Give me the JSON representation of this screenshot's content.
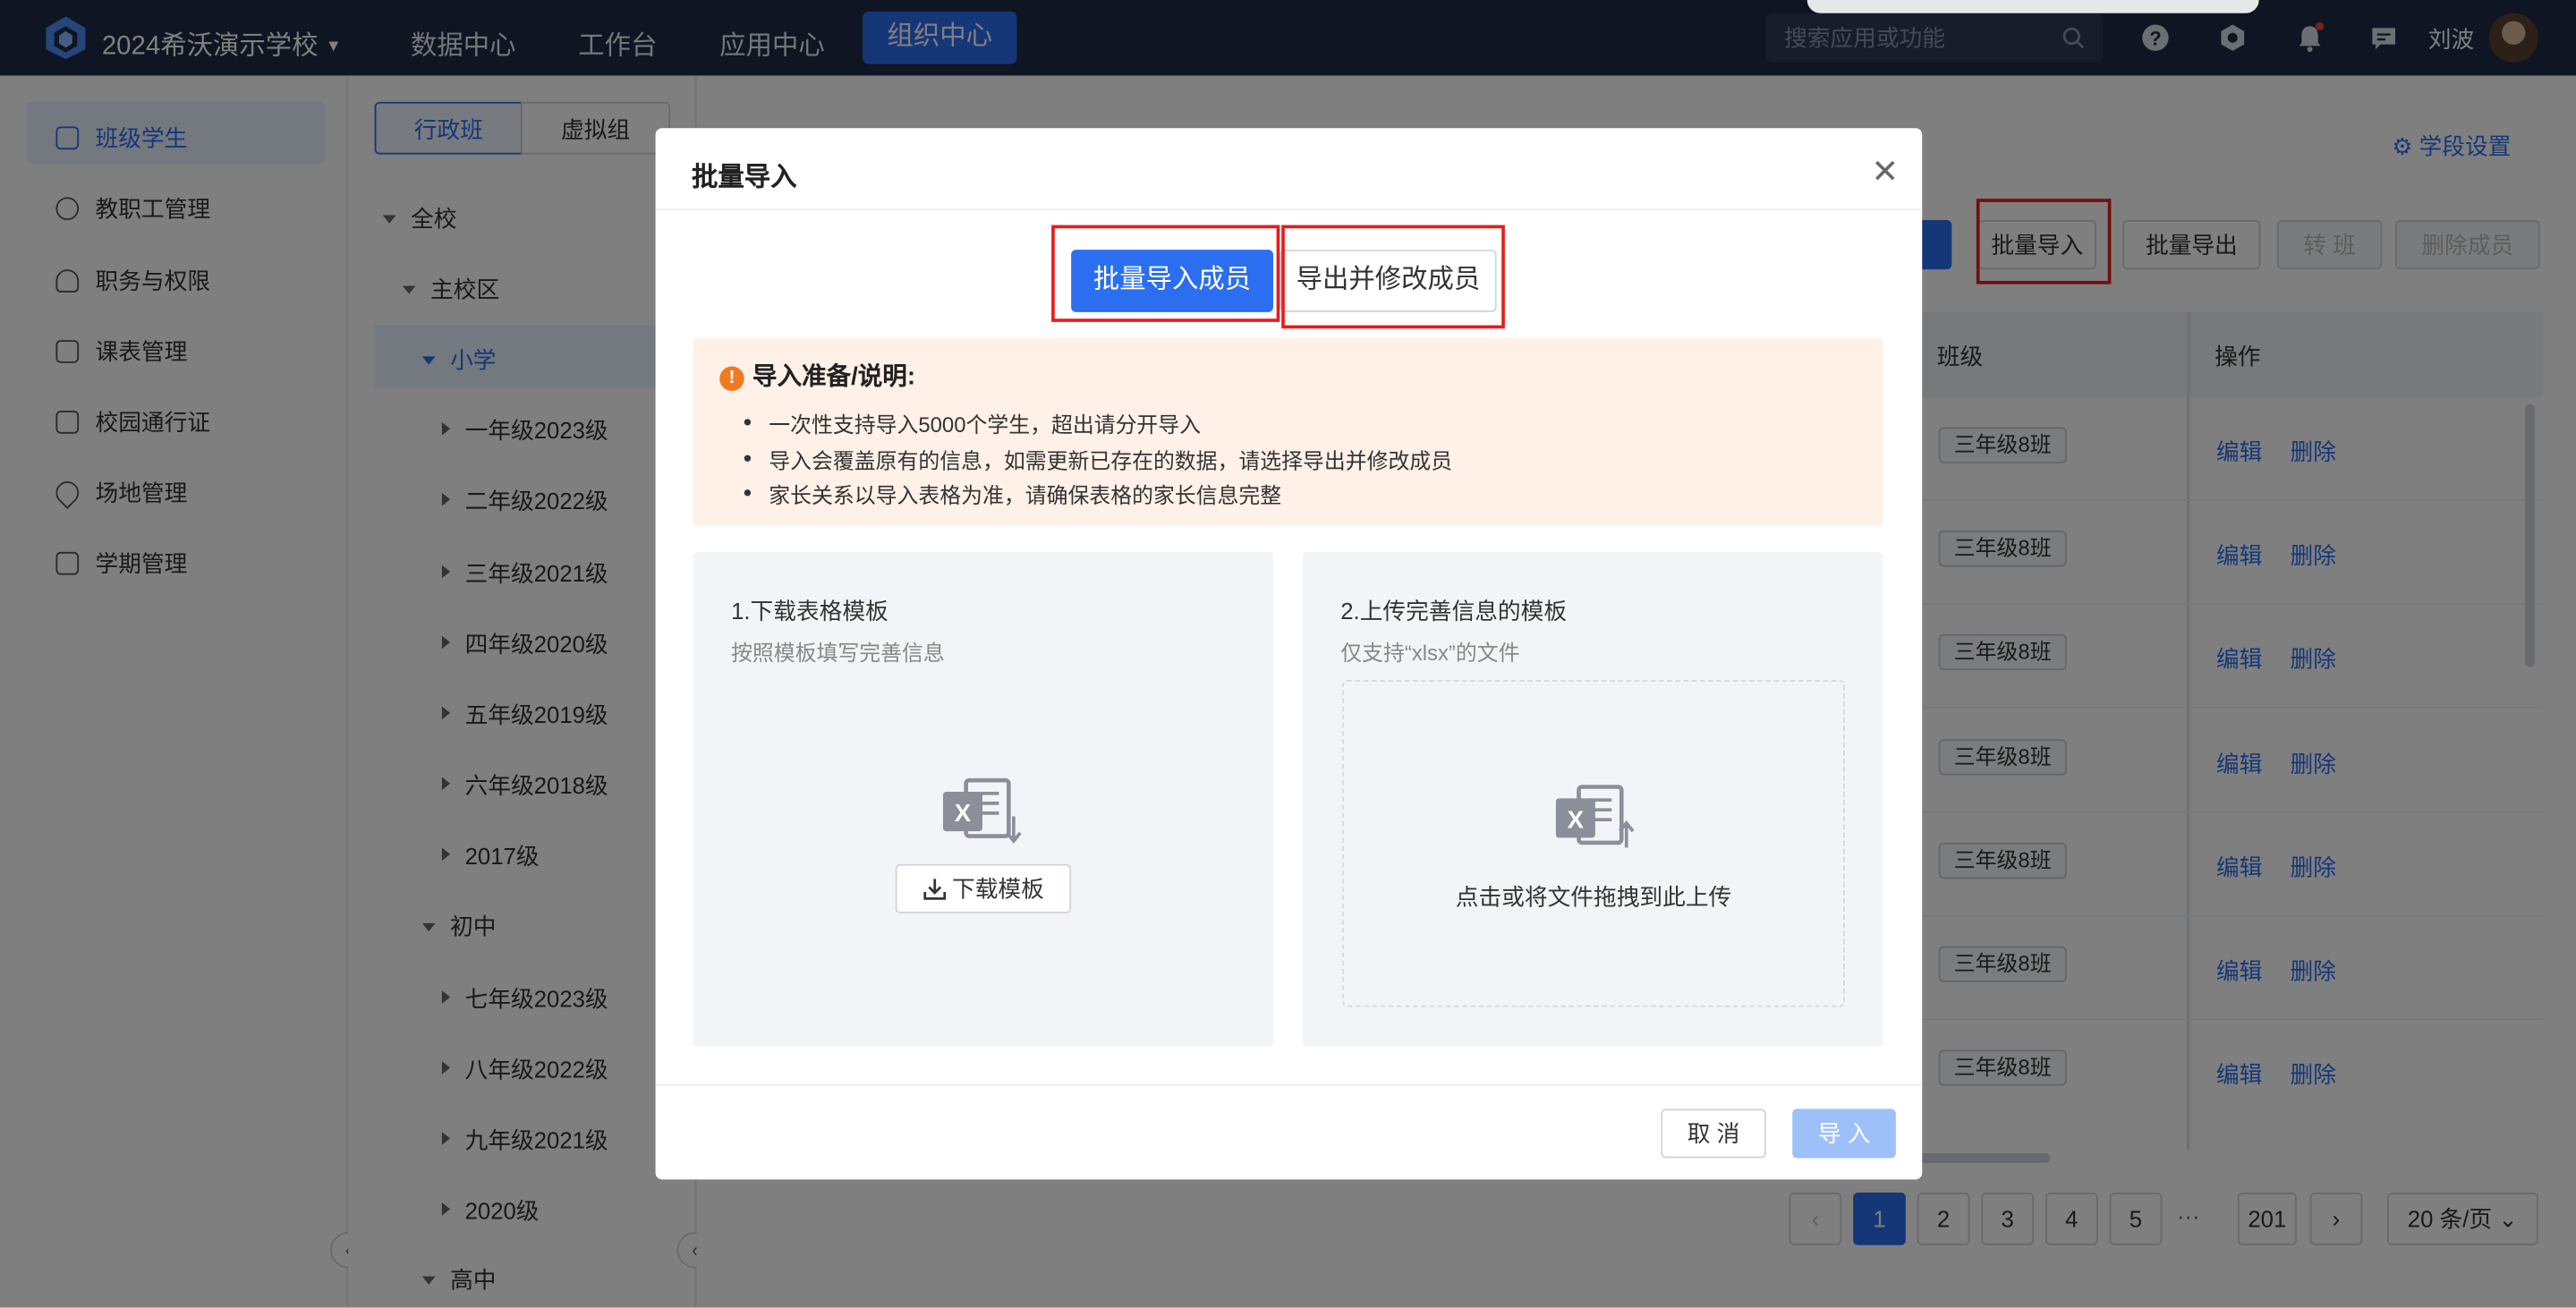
{
  "topbar": {
    "school_name": "2024希沃演示学校",
    "nav": [
      "数据中心",
      "工作台",
      "应用中心",
      "组织中心"
    ],
    "active_nav": "组织中心",
    "search_placeholder": "搜索应用或功能",
    "username": "刘波"
  },
  "sidebar": {
    "items": [
      {
        "label": "班级学生",
        "icon": "class-icon",
        "active": true
      },
      {
        "label": "教职工管理",
        "icon": "person-icon"
      },
      {
        "label": "职务与权限",
        "icon": "role-icon"
      },
      {
        "label": "课表管理",
        "icon": "calendar-icon"
      },
      {
        "label": "校园通行证",
        "icon": "card-icon"
      },
      {
        "label": "场地管理",
        "icon": "location-icon"
      },
      {
        "label": "学期管理",
        "icon": "term-icon"
      }
    ]
  },
  "tree": {
    "tabs": [
      "行政班",
      "虚拟组"
    ],
    "nodes": [
      "全校",
      "主校区",
      "小学",
      "一年级2023级",
      "二年级2022级",
      "三年级2021级",
      "四年级2020级",
      "五年级2019级",
      "六年级2018级",
      "2017级",
      "初中",
      "七年级2023级",
      "八年级2022级",
      "九年级2021级",
      "2020级",
      "高中"
    ]
  },
  "main": {
    "stage_settings": "学段设置",
    "actions": [
      "批量导入",
      "批量导出",
      "转 班",
      "删除成员"
    ],
    "table_headers": [
      "班级",
      "操作"
    ],
    "rows": [
      {
        "class": "三年级8班",
        "edit": "编辑",
        "delete": "删除"
      },
      {
        "class": "三年级8班",
        "edit": "编辑",
        "delete": "删除"
      },
      {
        "class": "三年级8班",
        "edit": "编辑",
        "delete": "删除"
      },
      {
        "class": "三年级8班",
        "edit": "编辑",
        "delete": "删除"
      },
      {
        "class": "三年级8班",
        "edit": "编辑",
        "delete": "删除"
      },
      {
        "class": "三年级8班",
        "edit": "编辑",
        "delete": "删除"
      },
      {
        "class": "三年级8班",
        "edit": "编辑",
        "delete": "删除"
      }
    ],
    "pagination": {
      "pages": [
        "1",
        "2",
        "3",
        "4",
        "5",
        "···",
        "201"
      ],
      "current": "1",
      "page_size": "20 条/页"
    }
  },
  "modal": {
    "title": "批量导入",
    "tabs": [
      "批量导入成员",
      "导出并修改成员"
    ],
    "notice": {
      "title": "导入准备/说明:",
      "items": [
        "一次性支持导入5000个学生，超出请分开导入",
        "导入会覆盖原有的信息，如需更新已存在的数据，请选择导出并修改成员",
        "家长关系以导入表格为准，请确保表格的家长信息完整"
      ]
    },
    "step1": {
      "title": "1.下载表格模板",
      "subtitle": "按照模板填写完善信息",
      "button": "下载模板"
    },
    "step2": {
      "title": "2.上传完善信息的模板",
      "subtitle": "仅支持“xlsx”的文件",
      "drop_text": "点击或将文件拖拽到此上传"
    },
    "cancel": "取 消",
    "import": "导 入"
  },
  "colors": {
    "primary": "#2b6ff0",
    "topbar": "#1e2b45",
    "highlight_box": "#e81c1c",
    "notice_bg": "#fff1e8"
  }
}
